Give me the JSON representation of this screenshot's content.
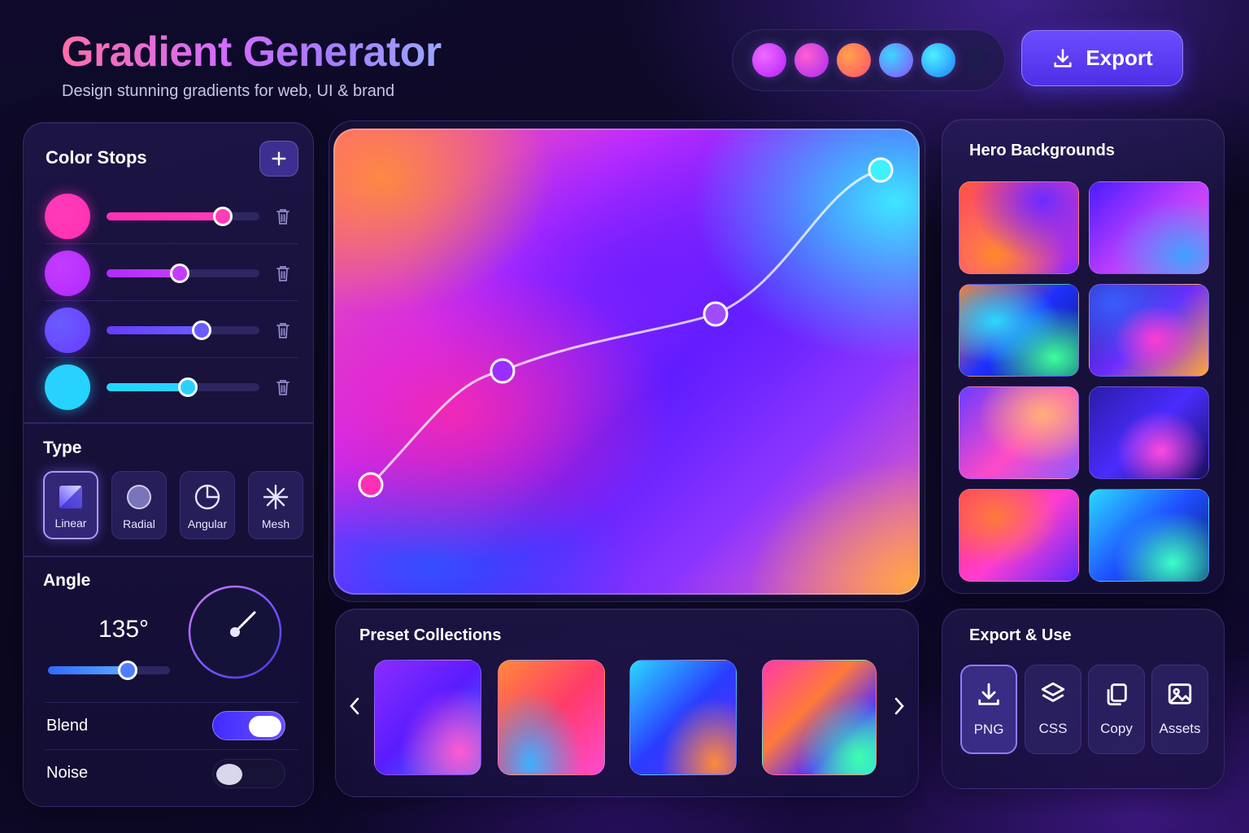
{
  "header": {
    "title": "Gradient Generator",
    "subtitle": "Design stunning gradients for web, UI & brand",
    "swatches": [
      "#d23cff",
      "#c93ce6",
      "#ff7a45",
      "#4fb4ff",
      "#2fc4ff",
      "#1c1850"
    ],
    "export_label": "Export"
  },
  "color_stops": {
    "title": "Color Stops",
    "stops": [
      {
        "color": "#ff2fb5",
        "fill": "#ff3cb8",
        "position": 0.76
      },
      {
        "color": "#b02aff",
        "fill": "#c43cff",
        "position": 0.48
      },
      {
        "color": "#6a3cff",
        "fill": "#6a5cff",
        "position": 0.62
      },
      {
        "color": "#22d6ff",
        "fill": "#2ad0ff",
        "position": 0.53
      }
    ]
  },
  "type": {
    "title": "Type",
    "options": [
      {
        "label": "Linear",
        "icon": "linear-icon",
        "active": true
      },
      {
        "label": "Radial",
        "icon": "radial-icon",
        "active": false
      },
      {
        "label": "Angular",
        "icon": "angular-icon",
        "active": false
      },
      {
        "label": "Mesh",
        "icon": "mesh-icon",
        "active": false
      }
    ]
  },
  "angle": {
    "title": "Angle",
    "value_label": "135°",
    "value": 135,
    "slider_fraction": 0.65
  },
  "blend": {
    "label": "Blend",
    "on": true
  },
  "noise": {
    "label": "Noise",
    "on": false
  },
  "hero": {
    "title": "Hero Backgrounds",
    "count": 8
  },
  "presets": {
    "title": "Preset Collections",
    "count": 4
  },
  "export_use": {
    "title": "Export & Use",
    "actions": [
      {
        "label": "PNG",
        "icon": "download-icon",
        "active": true
      },
      {
        "label": "CSS",
        "icon": "layers-icon",
        "active": false
      },
      {
        "label": "Copy",
        "icon": "copy-icon",
        "active": false
      },
      {
        "label": "Assets",
        "icon": "image-icon",
        "active": false
      }
    ]
  }
}
